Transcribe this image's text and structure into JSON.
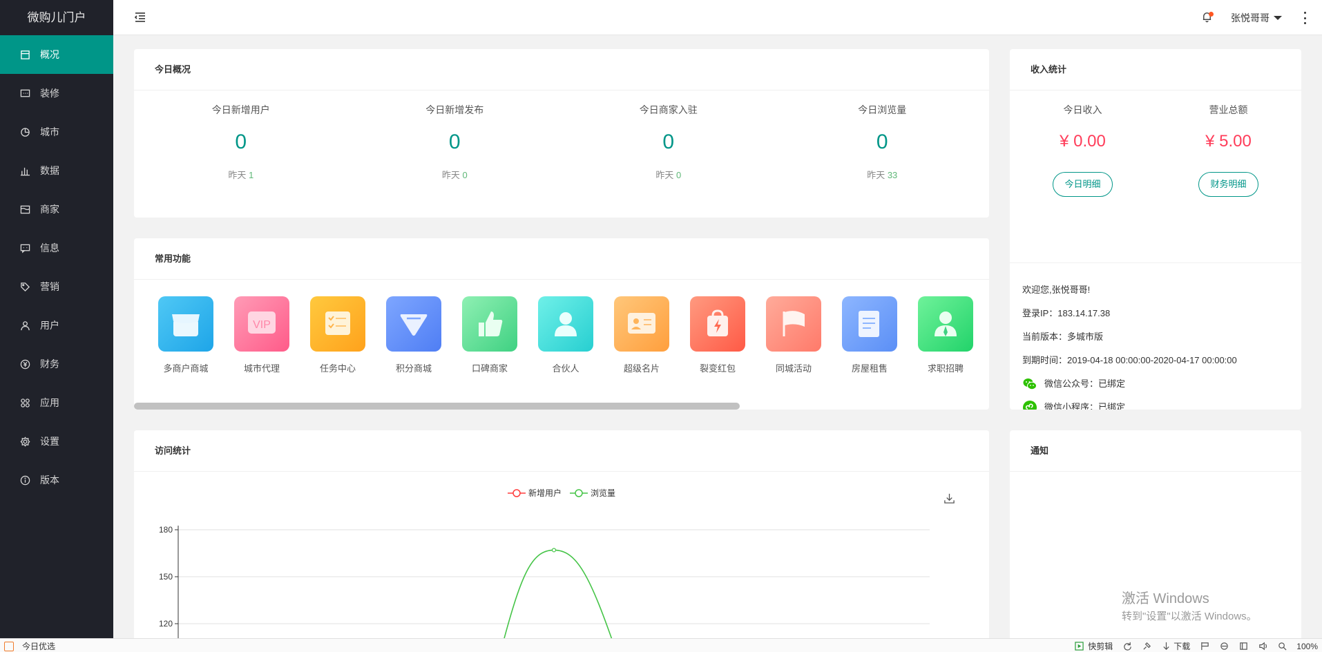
{
  "app": {
    "logo": "微购儿门户"
  },
  "sidebar": {
    "items": [
      {
        "label": "概况",
        "icon": "overview-icon",
        "active": true
      },
      {
        "label": "装修",
        "icon": "decorate-icon"
      },
      {
        "label": "城市",
        "icon": "city-icon"
      },
      {
        "label": "数据",
        "icon": "data-icon"
      },
      {
        "label": "商家",
        "icon": "merchant-icon"
      },
      {
        "label": "信息",
        "icon": "message-icon"
      },
      {
        "label": "营销",
        "icon": "tag-icon"
      },
      {
        "label": "用户",
        "icon": "user-icon"
      },
      {
        "label": "财务",
        "icon": "yen-icon"
      },
      {
        "label": "应用",
        "icon": "apps-icon"
      },
      {
        "label": "设置",
        "icon": "gear-icon"
      },
      {
        "label": "版本",
        "icon": "info-icon"
      }
    ]
  },
  "header": {
    "username": "张悦哥哥"
  },
  "today": {
    "title": "今日概况",
    "stats": [
      {
        "label": "今日新增用户",
        "value": "0",
        "yesterday_label": "昨天",
        "yesterday": "1"
      },
      {
        "label": "今日新增发布",
        "value": "0",
        "yesterday_label": "昨天",
        "yesterday": "0"
      },
      {
        "label": "今日商家入驻",
        "value": "0",
        "yesterday_label": "昨天",
        "yesterday": "0"
      },
      {
        "label": "今日浏览量",
        "value": "0",
        "yesterday_label": "昨天",
        "yesterday": "33"
      }
    ]
  },
  "income": {
    "title": "收入统计",
    "items": [
      {
        "label": "今日收入",
        "value": "¥ 0.00",
        "button": "今日明细"
      },
      {
        "label": "营业总额",
        "value": "¥ 5.00",
        "button": "财务明细"
      }
    ],
    "info": {
      "welcome": "欢迎您,张悦哥哥!",
      "ip": "登录IP：183.14.17.38",
      "version": "当前版本：多城市版",
      "expire": "到期时间：2019-04-18 00:00:00-2020-04-17 00:00:00",
      "wechat_official": "微信公众号：已绑定",
      "wechat_mini": "微信小程序：已绑定"
    }
  },
  "functions": {
    "title": "常用功能",
    "items": [
      {
        "name": "多商户商城",
        "colors": [
          "#4fc8f5",
          "#1ea5e8"
        ],
        "icon": "shop-icon"
      },
      {
        "name": "城市代理",
        "colors": [
          "#ff9bb6",
          "#ff5b89"
        ],
        "icon": "vip-icon"
      },
      {
        "name": "任务中心",
        "colors": [
          "#ffc93e",
          "#ffa21c"
        ],
        "icon": "task-icon"
      },
      {
        "name": "积分商城",
        "colors": [
          "#7ea6ff",
          "#4f7ef4"
        ],
        "icon": "points-icon"
      },
      {
        "name": "口碑商家",
        "colors": [
          "#8ff0b3",
          "#3fd182"
        ],
        "icon": "thumb-icon"
      },
      {
        "name": "合伙人",
        "colors": [
          "#6ff0e8",
          "#27cfd1"
        ],
        "icon": "partner-icon"
      },
      {
        "name": "超级名片",
        "colors": [
          "#ffc77a",
          "#ff9f3d"
        ],
        "icon": "card-icon"
      },
      {
        "name": "裂变红包",
        "colors": [
          "#ff9a80",
          "#ff5a46"
        ],
        "icon": "redpacket-icon"
      },
      {
        "name": "同城活动",
        "colors": [
          "#ffab9a",
          "#ff7a6a"
        ],
        "icon": "flag-icon"
      },
      {
        "name": "房屋租售",
        "colors": [
          "#8db6ff",
          "#5b8ff6"
        ],
        "icon": "house-doc-icon"
      },
      {
        "name": "求职招聘",
        "colors": [
          "#6ff29a",
          "#22d36a"
        ],
        "icon": "job-icon"
      },
      {
        "name": "",
        "colors": [
          "#5feee0",
          "#23d0c8"
        ],
        "icon": "partial-icon"
      }
    ]
  },
  "visit": {
    "title": "访问统计",
    "legend": [
      "新增用户",
      "浏览量"
    ]
  },
  "notice": {
    "title": "通知"
  },
  "watermark": {
    "line1": "激活 Windows",
    "line2": "转到\"设置\"以激活 Windows。"
  },
  "taskbar": {
    "left": "今日优选",
    "clip": "快剪辑",
    "download": "下载",
    "zoom": "100%"
  },
  "chart_data": {
    "type": "line",
    "legend": [
      "新增用户",
      "浏览量"
    ],
    "colors": {
      "新增用户": "#ff3b3b",
      "浏览量": "#45c447"
    },
    "ylim": [
      0,
      180
    ],
    "yticks": [
      120,
      150,
      180
    ],
    "series": [
      {
        "name": "浏览量",
        "peak": 167
      }
    ],
    "grid": true,
    "legend_position": "top-center"
  }
}
